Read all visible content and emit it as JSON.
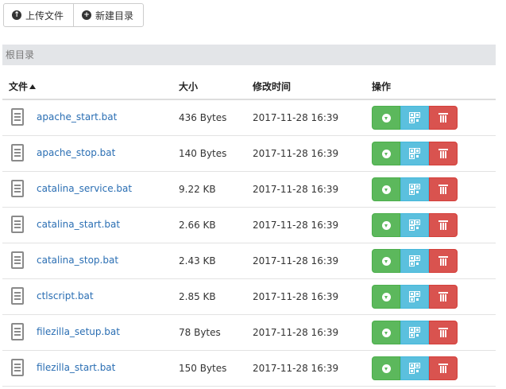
{
  "toolbar": {
    "upload_label": "上传文件",
    "new_folder_label": "新建目录"
  },
  "breadcrumb": {
    "label": "根目录"
  },
  "table": {
    "headers": {
      "name": "文件",
      "size": "大小",
      "modified": "修改时间",
      "actions": "操作"
    },
    "sort": {
      "column": "name",
      "direction": "ascending"
    },
    "rows": [
      {
        "name": "apache_start.bat",
        "size": "436 Bytes",
        "modified": "2017-11-28 16:39"
      },
      {
        "name": "apache_stop.bat",
        "size": "140 Bytes",
        "modified": "2017-11-28 16:39"
      },
      {
        "name": "catalina_service.bat",
        "size": "9.22 KB",
        "modified": "2017-11-28 16:39"
      },
      {
        "name": "catalina_start.bat",
        "size": "2.66 KB",
        "modified": "2017-11-28 16:39"
      },
      {
        "name": "catalina_stop.bat",
        "size": "2.43 KB",
        "modified": "2017-11-28 16:39"
      },
      {
        "name": "ctlscript.bat",
        "size": "2.85 KB",
        "modified": "2017-11-28 16:39"
      },
      {
        "name": "filezilla_setup.bat",
        "size": "78 Bytes",
        "modified": "2017-11-28 16:39"
      },
      {
        "name": "filezilla_start.bat",
        "size": "150 Bytes",
        "modified": "2017-11-28 16:39"
      }
    ]
  },
  "icons": {
    "upload": "upload-circle-icon",
    "new_folder": "plus-circle-icon",
    "file": "file-text-icon",
    "download": "download-circle-icon",
    "qrcode": "qrcode-icon",
    "delete": "trash-icon"
  },
  "colors": {
    "link": "#2a6eb3",
    "download": "#5cb85c",
    "qrcode": "#5bc0de",
    "delete": "#d9534f",
    "breadcrumb_bg": "#e3e5e8"
  }
}
